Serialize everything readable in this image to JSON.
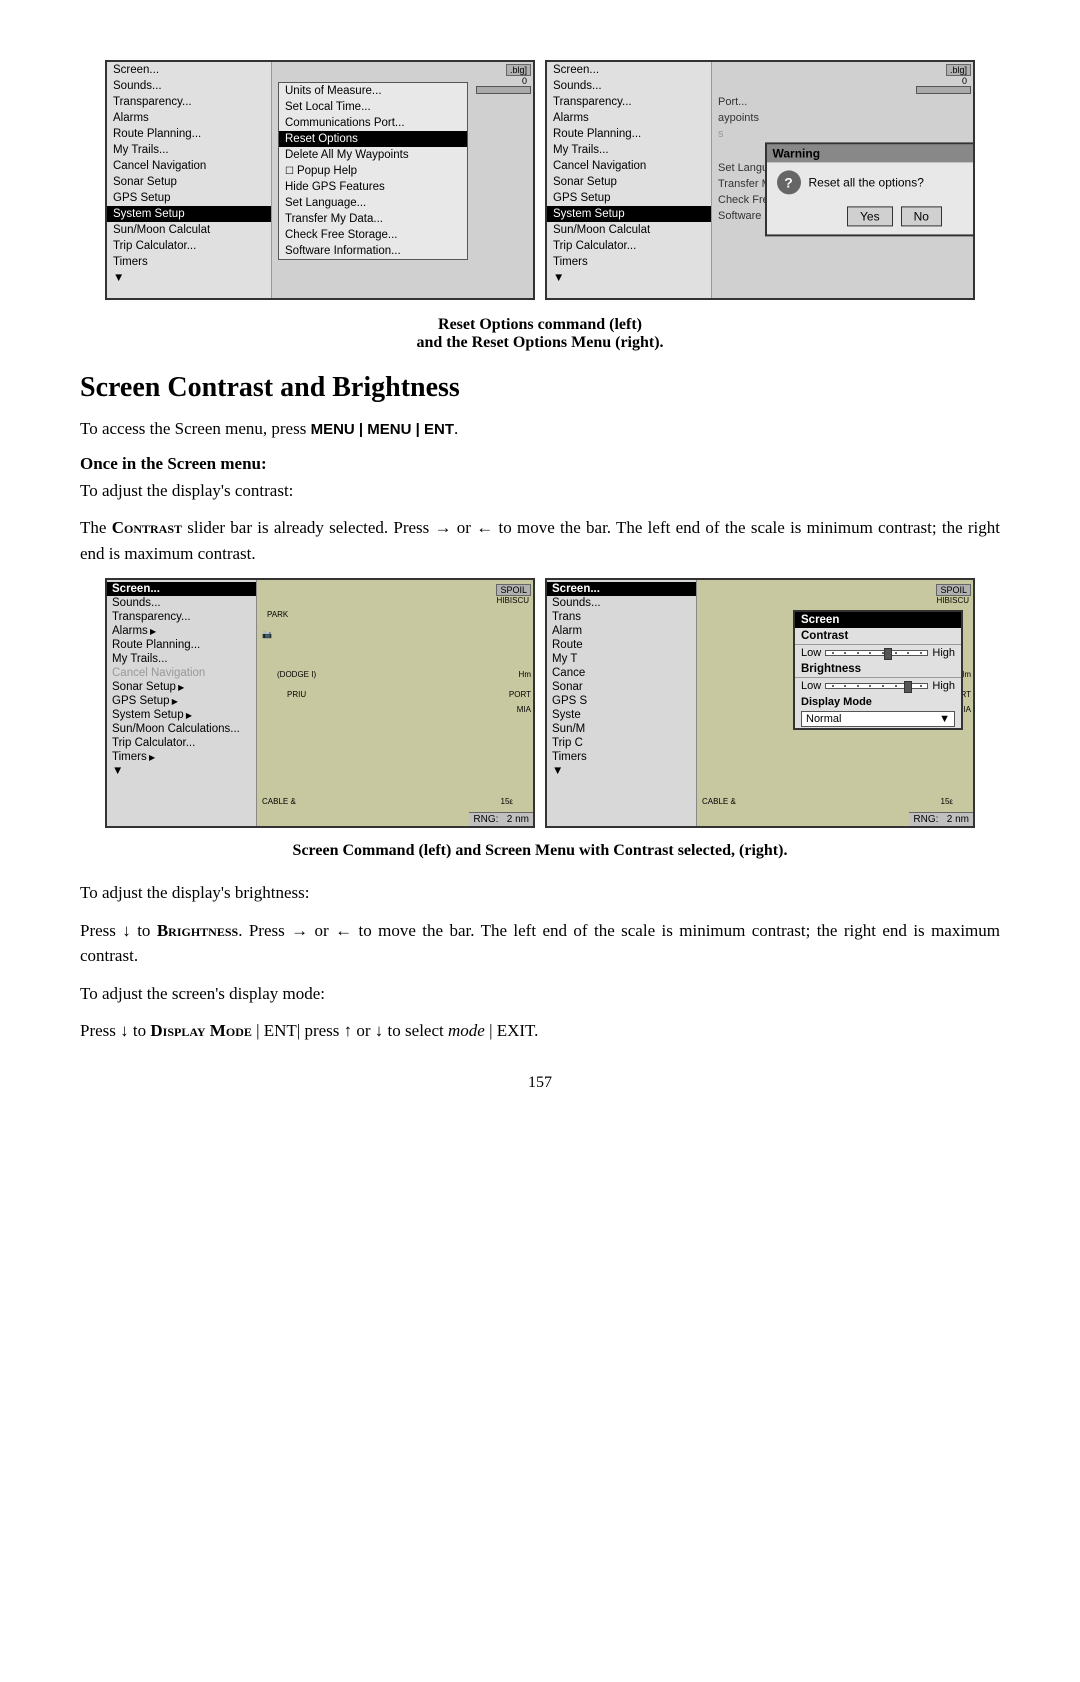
{
  "top_screenshots": {
    "left": {
      "menu_items": [
        {
          "label": "Screen...",
          "selected": false
        },
        {
          "label": "Sounds...",
          "selected": false
        },
        {
          "label": "Transparency...",
          "selected": false
        },
        {
          "label": "Alarms",
          "selected": false
        },
        {
          "label": "Route Planning...",
          "selected": false
        },
        {
          "label": "My Trails...",
          "selected": false
        },
        {
          "label": "Cancel Navigation",
          "selected": false
        },
        {
          "label": "Sonar Setup",
          "selected": false
        },
        {
          "label": "GPS Setup",
          "selected": false
        },
        {
          "label": "System Setup",
          "selected": true
        },
        {
          "label": "Sun/Moon Calculat",
          "selected": false
        },
        {
          "label": "Trip Calculator...",
          "selected": false
        },
        {
          "label": "Timers",
          "selected": false
        }
      ],
      "submenu_items": [
        {
          "label": "Units of Measure...",
          "selected": false
        },
        {
          "label": "Set Local Time...",
          "selected": false
        },
        {
          "label": "Communications Port...",
          "selected": false
        },
        {
          "label": "Reset Options",
          "selected": true
        },
        {
          "label": "Delete All My Waypoints",
          "selected": false
        },
        {
          "label": "Popup Help",
          "checkbox": true,
          "selected": false
        },
        {
          "label": "Hide GPS Features",
          "selected": false
        },
        {
          "label": "Set Language...",
          "selected": false
        },
        {
          "label": "Transfer My Data...",
          "selected": false
        },
        {
          "label": "Check Free Storage...",
          "selected": false
        },
        {
          "label": "Software Information...",
          "selected": false
        }
      ]
    },
    "right": {
      "menu_items": [
        {
          "label": "Screen...",
          "selected": false
        },
        {
          "label": "Sounds...",
          "selected": false
        },
        {
          "label": "Transparency...",
          "selected": false
        },
        {
          "label": "Alarms",
          "selected": false
        },
        {
          "label": "Route Planning...",
          "selected": false
        },
        {
          "label": "My Trails...",
          "selected": false
        },
        {
          "label": "Cancel Navigation",
          "selected": false
        },
        {
          "label": "Sonar Setup",
          "selected": false
        },
        {
          "label": "GPS Setup",
          "selected": false
        },
        {
          "label": "System Setup",
          "selected": true
        },
        {
          "label": "Sun/Moon Calculat",
          "selected": false
        },
        {
          "label": "Trip Calculator...",
          "selected": false
        },
        {
          "label": "Timers",
          "selected": false
        }
      ],
      "warning": {
        "title": "Warning",
        "message": "Reset all the options?",
        "yes": "Yes",
        "no": "No"
      },
      "submenu_partial": [
        {
          "label": "Port..."
        },
        {
          "label": "aypoints"
        }
      ],
      "lower_items": [
        {
          "label": "Set Language..."
        },
        {
          "label": "Transfer My Data..."
        },
        {
          "label": "Check Free Storage..."
        },
        {
          "label": "Software Information..."
        }
      ]
    }
  },
  "caption": {
    "line1": "Reset Options command (left)",
    "line2": "and the Reset Options Menu (right)."
  },
  "section_title": "Screen Contrast and Brightness",
  "para1": "To access the Screen menu, press ",
  "para1_kbd": "MENU | MENU | ENT",
  "para1_end": ".",
  "once_label": "Once in the Screen menu:",
  "para2": "To adjust the display's contrast:",
  "para3_before": "The ",
  "para3_small": "Contrast",
  "para3_after": " slider bar is already selected. Press → or ← to move the bar. The left end of the scale is minimum contrast; the right end is maximum contrast.",
  "bottom_screenshots": {
    "left": {
      "title": "Screen...",
      "menu_items": [
        {
          "label": "Sounds...",
          "selected": false
        },
        {
          "label": "Transparency...",
          "selected": false
        },
        {
          "label": "Alarms",
          "selected": false,
          "arrow": true
        },
        {
          "label": "Route Planning...",
          "selected": false
        },
        {
          "label": "My Trails...",
          "selected": false
        },
        {
          "label": "Cancel Navigation",
          "selected": false,
          "gray": true
        },
        {
          "label": "Sonar Setup",
          "selected": false,
          "arrow": true
        },
        {
          "label": "GPS Setup",
          "selected": false,
          "arrow": true
        },
        {
          "label": "System Setup",
          "selected": false,
          "arrow": true
        },
        {
          "label": "Sun/Moon Calculations...",
          "selected": false
        },
        {
          "label": "Trip Calculator...",
          "selected": false
        },
        {
          "label": "Timers",
          "selected": false,
          "arrow": true
        }
      ]
    },
    "right": {
      "title": "Screen...",
      "menu_items": [
        {
          "label": "Sounds...",
          "selected": false
        },
        {
          "label": "Trans",
          "selected": false
        },
        {
          "label": "Alarm",
          "selected": false
        },
        {
          "label": "Route",
          "selected": false
        },
        {
          "label": "My T",
          "selected": false
        },
        {
          "label": "Cance",
          "selected": false
        },
        {
          "label": "Sonar",
          "selected": false
        },
        {
          "label": "GPS S",
          "selected": false
        },
        {
          "label": "Syste",
          "selected": false
        },
        {
          "label": "Sun/M",
          "selected": false
        },
        {
          "label": "Trip C",
          "selected": false
        },
        {
          "label": "Timers",
          "selected": false
        }
      ],
      "screen_popup": {
        "title": "Screen",
        "contrast_label": "Contrast",
        "low": "Low",
        "high": "High",
        "brightness_label": "Brightness",
        "low2": "Low",
        "high2": "High",
        "display_mode_label": "Display Mode",
        "display_mode_value": "Normal"
      }
    }
  },
  "caption2": {
    "line1": "Screen Command (left) and Screen Menu with Contrast selected, (right)."
  },
  "para4": "To adjust the display's brightness:",
  "para5_before": "Press ↓ to ",
  "para5_small": "Brightness",
  "para5_after": ". Press → or ← to move the bar. The left end of the scale is minimum contrast; the right end is maximum contrast.",
  "para6": "To adjust the screen's display mode:",
  "para7_before": "Press ↓ to ",
  "para7_small": "Display Mode",
  "para7_mid": " | ENT| press ↑ or ↓ to select ",
  "para7_italic": "mode",
  "para7_end": " | EXIT",
  "para7_period": ".",
  "page_number": "157"
}
